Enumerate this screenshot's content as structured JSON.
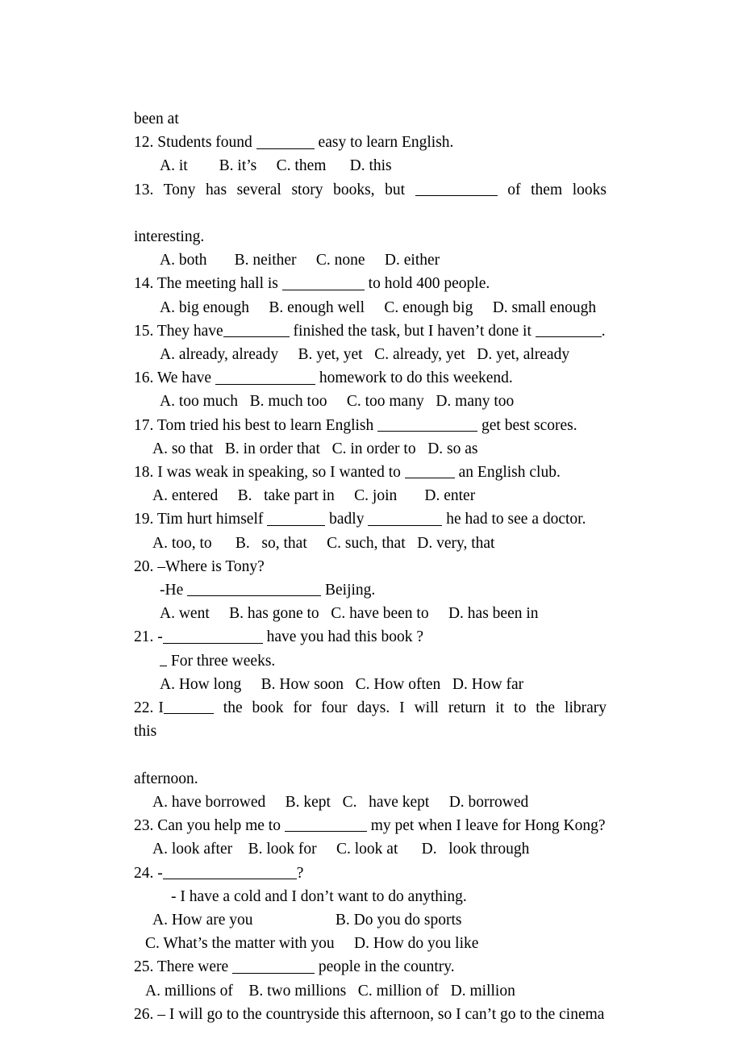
{
  "document": {
    "type": "english-grammar-worksheet",
    "page_background": "#ffffff",
    "text_color": "#000000",
    "carryover_text": "been at",
    "items": [
      {
        "number": "12.",
        "stem_before": "12. Students found ",
        "stem_after": " easy to learn English.",
        "options_line1": "A. it        B. it’s     C. them      D. this"
      },
      {
        "number": "13.",
        "stem_before": "13.  Tony  has  several  story  books,  but  ",
        "stem_after": "  of  them  looks",
        "stem_continuation": "interesting.",
        "options_line1": "A. both       B. neither     C. none     D. either"
      },
      {
        "number": "14.",
        "stem_before": "14. The meeting hall is ",
        "stem_after": " to hold 400 people.",
        "options_line1": "A. big enough     B. enough well     C. enough big     D. small enough"
      },
      {
        "number": "15.",
        "stem_before": "15. They have",
        "stem_middle": " finished the task, but I haven’t done it ",
        "stem_after": ".",
        "options_line1": "A. already, already     B. yet, yet   C. already, yet   D. yet, already"
      },
      {
        "number": "16.",
        "stem_before": "16. We have ",
        "stem_after": " homework to do this weekend.",
        "options_line1": "A. too much   B. much too     C. too many   D. many too"
      },
      {
        "number": "17.",
        "stem_before": "17. Tom tried his best to learn English ",
        "stem_after": " get best scores.",
        "options_line1": "A. so that   B. in order that   C. in order to   D. so as"
      },
      {
        "number": "18.",
        "stem_before": "18. I was weak in speaking, so I wanted to ",
        "stem_after": " an English club.",
        "options_line1": "A. entered     B.   take part in     C. join       D. enter"
      },
      {
        "number": "19.",
        "stem_before": "19. Tim hurt himself ",
        "stem_middle": " badly ",
        "stem_after": " he had to see a doctor.",
        "options_line1": "A. too, to      B.   so, that     C. such, that   D. very, that"
      },
      {
        "number": "20.",
        "stem_before": "20. –Where is Tony?",
        "answer_before": "-He ",
        "answer_after": " Beijing.",
        "options_line1": "A. went     B. has gone to   C. have been to     D. has been in"
      },
      {
        "number": "21.",
        "stem_before": "21. -",
        "stem_after": " have you had this book ?",
        "answer_after": " For three weeks.",
        "options_line1": "A. How long     B. How soon   C. How often   D. How far"
      },
      {
        "number": "22.",
        "stem_before": "22. I",
        "stem_after": "  the  book  for  four  days.  I  will  return  it  to  the  library  this",
        "stem_continuation": "afternoon.",
        "options_line1": "A. have borrowed     B. kept   C.   have kept     D. borrowed"
      },
      {
        "number": "23.",
        "stem_before": "23. Can you help me to ",
        "stem_after": " my pet when I leave for Hong Kong?",
        "options_line1": "A. look after    B. look for     C. look at      D.   look through"
      },
      {
        "number": "24.",
        "stem_before": "24. -",
        "stem_after": "?",
        "answer_line": "- I have a cold and I don’t want to do anything.",
        "options_line1": "A. How are you                     B. Do you do sports",
        "options_line2": "C. What’s the matter with you     D. How do you like"
      },
      {
        "number": "25.",
        "stem_before": "25. There were ",
        "stem_after": " people in the country.",
        "options_line1": "A. millions of    B. two millions   C. million of   D. million"
      },
      {
        "number": "26.",
        "stem_before": "26. – I will go to the countryside this afternoon, so I can’t go to the cinema"
      }
    ]
  }
}
